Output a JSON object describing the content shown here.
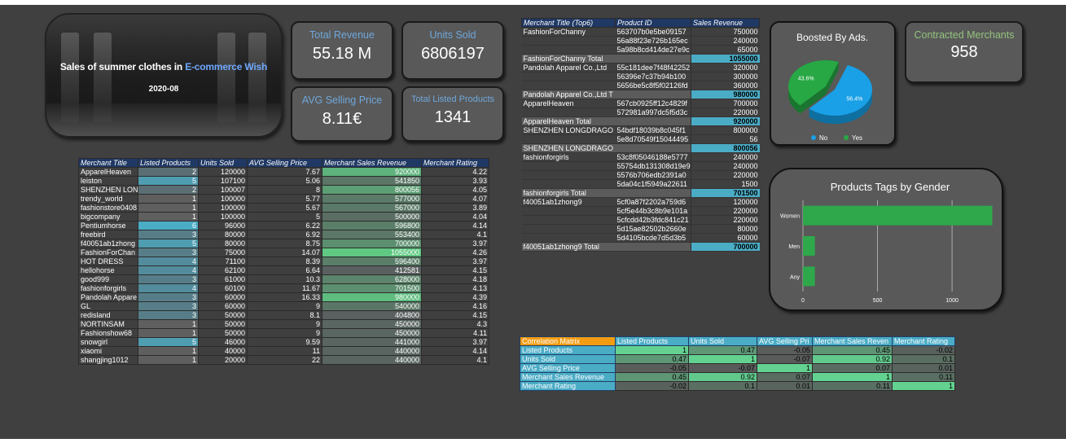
{
  "banner": {
    "title_part1": "Sales of summer clothes in ",
    "title_part2": "E-commerce Wish",
    "date": "2020-08"
  },
  "kpis": {
    "total_revenue": {
      "label": "Total Revenue",
      "value": "55.18 M"
    },
    "units_sold": {
      "label": "Units Sold",
      "value": "6806197"
    },
    "avg_price": {
      "label": "AVG Selling Price",
      "value": "8.11€"
    },
    "listed_products": {
      "label": "Total Listed Products",
      "value": "1341"
    },
    "contracted_merchants": {
      "label": "Contracted Merchants",
      "value": "958"
    }
  },
  "merchant_table": {
    "headers": [
      "Merchant Title",
      "Listed Products",
      "Units Sold",
      "AVG Selling Price",
      "Merchant Sales Revenue",
      "Merchant Rating"
    ],
    "rows": [
      [
        "ApparelHeaven",
        "2",
        "120000",
        "7.67",
        "920000",
        "4.22"
      ],
      [
        "leiston",
        "5",
        "107100",
        "5.06",
        "541850",
        "3.93"
      ],
      [
        "SHENZHEN LON",
        "2",
        "100007",
        "8",
        "800056",
        "4.05"
      ],
      [
        "trendy_world",
        "1",
        "100000",
        "5.77",
        "577000",
        "4.07"
      ],
      [
        "fashionstore0408",
        "1",
        "100000",
        "5.67",
        "567000",
        "3.89"
      ],
      [
        "bigcompany",
        "1",
        "100000",
        "5",
        "500000",
        "4.04"
      ],
      [
        "Pentiumhorse",
        "6",
        "96000",
        "6.22",
        "596800",
        "4.14"
      ],
      [
        "freebird",
        "3",
        "80000",
        "6.92",
        "553400",
        "4.1"
      ],
      [
        "f40051ab1zhong",
        "5",
        "80000",
        "8.75",
        "700000",
        "3.97"
      ],
      [
        "FashionForChan",
        "3",
        "75000",
        "14.07",
        "1055000",
        "4.26"
      ],
      [
        "HOT DRESS",
        "4",
        "71100",
        "8.39",
        "596400",
        "3.97"
      ],
      [
        "hellohorse",
        "4",
        "62100",
        "6.64",
        "412581",
        "4.15"
      ],
      [
        "good999",
        "3",
        "61000",
        "10.3",
        "628000",
        "4.18"
      ],
      [
        "fashionforgirls",
        "4",
        "60100",
        "11.67",
        "701500",
        "4.13"
      ],
      [
        "Pandolah Appare",
        "3",
        "60000",
        "16.33",
        "980000",
        "4.39"
      ],
      [
        "GL",
        "3",
        "60000",
        "9",
        "540000",
        "4.16"
      ],
      [
        "redisland",
        "3",
        "50000",
        "8.1",
        "404800",
        "4.15"
      ],
      [
        "NORTINSAM",
        "1",
        "50000",
        "9",
        "450000",
        "4.3"
      ],
      [
        "Fashionshow68",
        "1",
        "50000",
        "9",
        "450000",
        "4.11"
      ],
      [
        "snowgirl",
        "5",
        "46000",
        "9.59",
        "441000",
        "3.97"
      ],
      [
        "xiaomi",
        "1",
        "40000",
        "11",
        "440000",
        "4.14"
      ],
      [
        "shangjing1012",
        "1",
        "20000",
        "22",
        "440000",
        "4.1"
      ]
    ]
  },
  "pivot_table": {
    "headers": [
      "Merchant Title (Top6)",
      "Product ID",
      "Sales Revenue"
    ],
    "rows": [
      {
        "merchant": "FashionForChanny",
        "pid": "563707b0e5be09157",
        "rev": "750000",
        "total": false
      },
      {
        "merchant": "",
        "pid": "56a88f23e726b165ec",
        "rev": "240000",
        "total": false
      },
      {
        "merchant": "",
        "pid": "5a98b8cd414de27e9c",
        "rev": "65000",
        "total": false
      },
      {
        "merchant": "FashionForChanny  Total",
        "pid": "",
        "rev": "1055000",
        "total": true
      },
      {
        "merchant": "Pandolah Apparel Co.,Ltd",
        "pid": "55c181dee7f48f42252",
        "rev": "320000",
        "total": false
      },
      {
        "merchant": "",
        "pid": "56396e7c37b94b100",
        "rev": "300000",
        "total": false
      },
      {
        "merchant": "",
        "pid": "5656be5c8f5f02126fd",
        "rev": "360000",
        "total": false
      },
      {
        "merchant": "Pandolah Apparel Co.,Ltd T",
        "pid": "",
        "rev": "980000",
        "total": true
      },
      {
        "merchant": "ApparelHeaven",
        "pid": "567cb0925ff12c4829f",
        "rev": "700000",
        "total": false
      },
      {
        "merchant": "",
        "pid": "572981a997dc5f5d3c",
        "rev": "220000",
        "total": false
      },
      {
        "merchant": "ApparelHeaven Total",
        "pid": "",
        "rev": "920000",
        "total": true
      },
      {
        "merchant": "SHENZHEN LONGDRAGO",
        "pid": "54bdf18039b8c045f1",
        "rev": "800000",
        "total": false
      },
      {
        "merchant": "",
        "pid": "5e8d70549f15044495",
        "rev": "56",
        "total": false
      },
      {
        "merchant": "SHENZHEN LONGDRAGO",
        "pid": "",
        "rev": "800056",
        "total": true
      },
      {
        "merchant": "fashionforgirls",
        "pid": "53c8f05046188e5777",
        "rev": "240000",
        "total": false
      },
      {
        "merchant": "",
        "pid": "55754db131308d19e9",
        "rev": "240000",
        "total": false
      },
      {
        "merchant": "",
        "pid": "5576b706edb2391a0",
        "rev": "220000",
        "total": false
      },
      {
        "merchant": "",
        "pid": "5da04c1f5949a22611",
        "rev": "1500",
        "total": false
      },
      {
        "merchant": "fashionforgirls Total",
        "pid": "",
        "rev": "701500",
        "total": true
      },
      {
        "merchant": "f40051ab1zhong9",
        "pid": "5cf0a87f2202a759d6",
        "rev": "120000",
        "total": false
      },
      {
        "merchant": "",
        "pid": "5cf5e44b3c8b9e101a",
        "rev": "220000",
        "total": false
      },
      {
        "merchant": "",
        "pid": "5cfcdd42b3fdc841c21",
        "rev": "220000",
        "total": false
      },
      {
        "merchant": "",
        "pid": "5d15ae82502b2660e",
        "rev": "80000",
        "total": false
      },
      {
        "merchant": "",
        "pid": "5d4105bcde7d5d3b5",
        "rev": "60000",
        "total": false
      },
      {
        "merchant": "f40051ab1zhong9 Total",
        "pid": "",
        "rev": "700000",
        "total": true
      }
    ]
  },
  "correlation": {
    "title": "Correlation Matrix",
    "columns": [
      "Listed Products",
      "Units Sold",
      "AVG Selling Pri",
      "Merchant Sales Reven",
      "Merchant Rating"
    ],
    "rows": [
      {
        "label": "Listed Products",
        "values": [
          "1",
          "0.47",
          "-0.05",
          "0.45",
          "-0.02"
        ]
      },
      {
        "label": "Units Sold",
        "values": [
          "0.47",
          "1",
          "-0.07",
          "0.92",
          "0.1"
        ]
      },
      {
        "label": "AVG Selling Price",
        "values": [
          "-0.05",
          "-0.07",
          "1",
          "0.07",
          "0.01"
        ]
      },
      {
        "label": "Merchant Sales Revenue",
        "values": [
          "0.45",
          "0.92",
          "0.07",
          "1",
          "0.11"
        ]
      },
      {
        "label": "Merchant Rating",
        "values": [
          "-0.02",
          "0.1",
          "0.01",
          "0.11",
          "1"
        ]
      }
    ]
  },
  "chart_data": [
    {
      "type": "pie",
      "title": "Boosted By Ads.",
      "categories": [
        "No",
        "Yes"
      ],
      "values": [
        56.4,
        43.6
      ],
      "labels": [
        "56.4%",
        "43.6%"
      ],
      "colors": [
        "#1aa0e6",
        "#27a844"
      ],
      "legend": "bottom"
    },
    {
      "type": "bar",
      "orientation": "horizontal",
      "title": "Products Tags by Gender",
      "categories": [
        "Women",
        "Men",
        "Any"
      ],
      "values": [
        1270,
        80,
        80
      ],
      "xlim": [
        0,
        1300
      ],
      "xticks": [
        "0",
        "500",
        "1000"
      ],
      "color": "#2ea84a",
      "grid": true
    }
  ]
}
